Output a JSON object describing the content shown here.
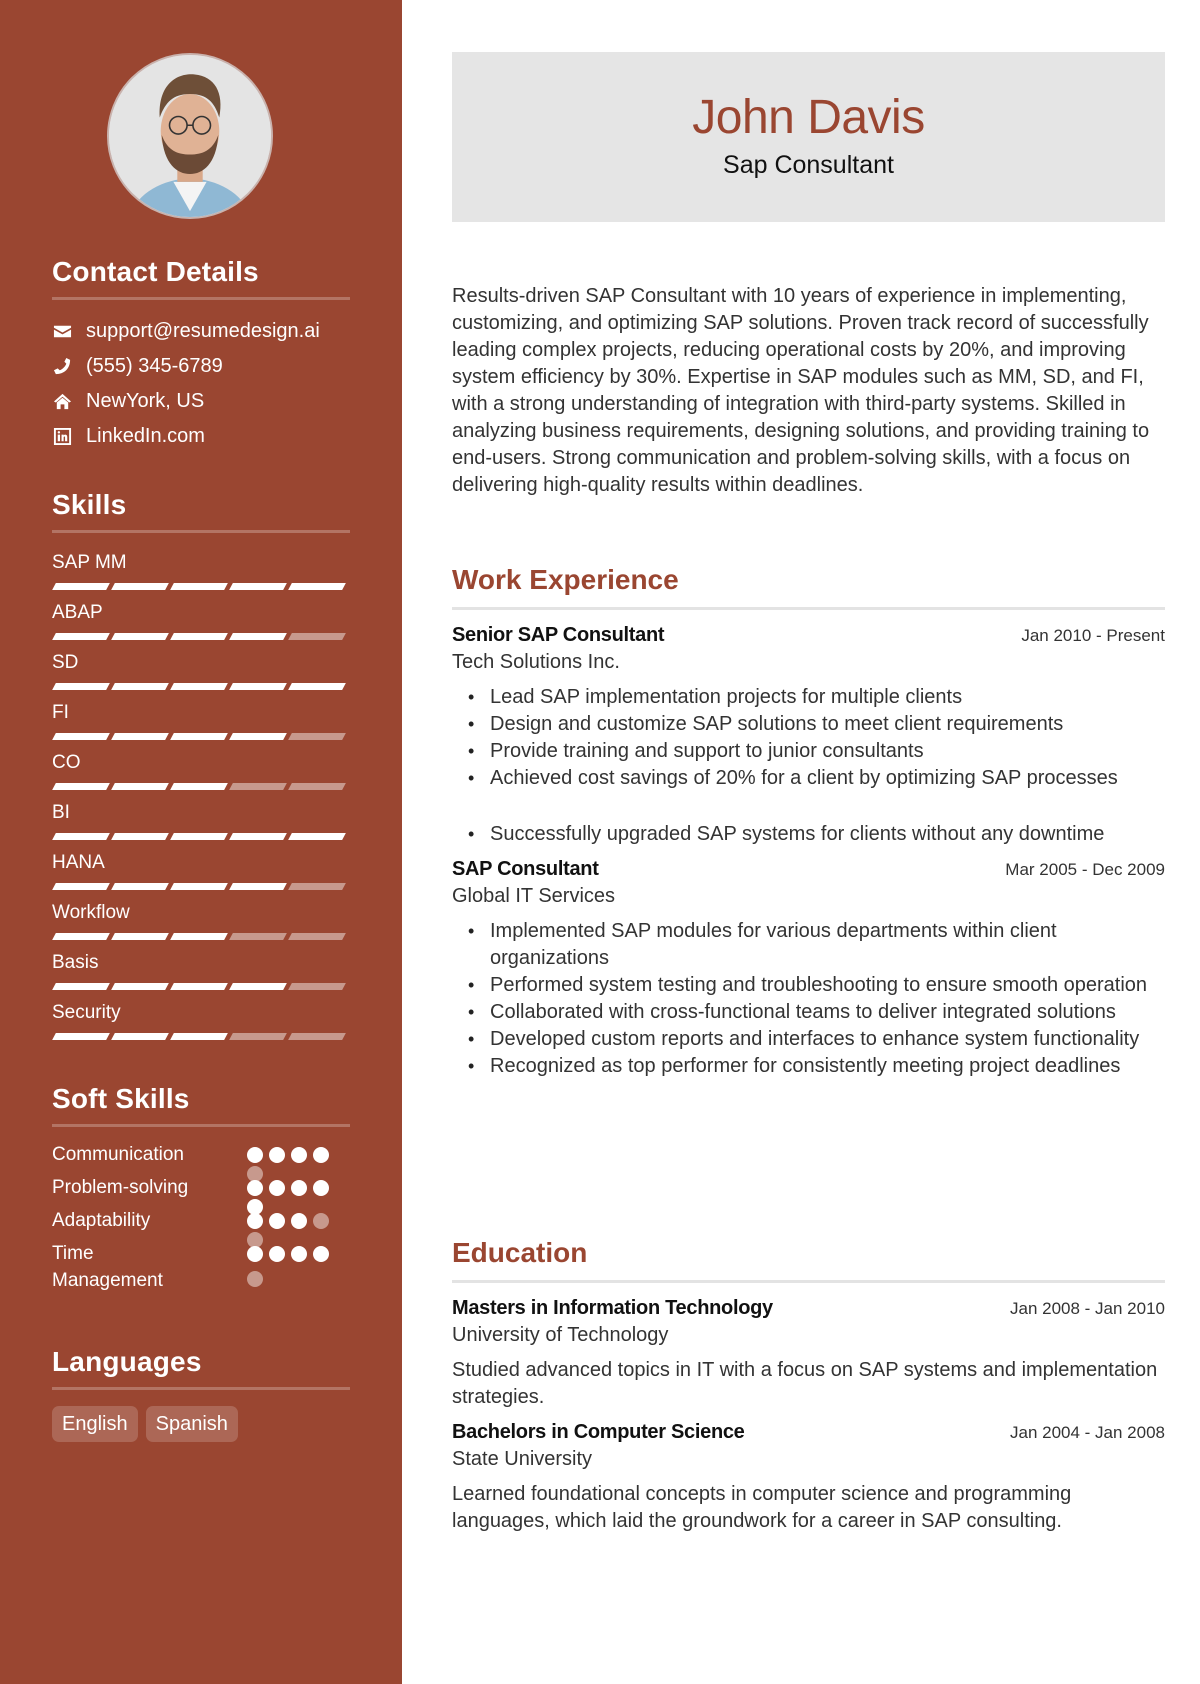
{
  "profile": {
    "name": "John Davis",
    "title": "Sap Consultant",
    "photo_alt": "profile-photo"
  },
  "colors": {
    "accent": "#9A4631",
    "header_bg": "#e5e5e5"
  },
  "contact": {
    "heading": "Contact Details",
    "items": [
      {
        "icon": "envelope-icon",
        "text": "support@resumedesign.ai"
      },
      {
        "icon": "phone-icon",
        "text": "(555) 345-6789"
      },
      {
        "icon": "home-icon",
        "text": "NewYork, US"
      },
      {
        "icon": "linkedin-icon",
        "text": "LinkedIn.com"
      }
    ]
  },
  "skills": {
    "heading": "Skills",
    "max": 5,
    "items": [
      {
        "name": "SAP MM",
        "level": 5
      },
      {
        "name": "ABAP",
        "level": 4
      },
      {
        "name": "SD",
        "level": 5
      },
      {
        "name": "FI",
        "level": 4
      },
      {
        "name": "CO",
        "level": 3
      },
      {
        "name": "BI",
        "level": 5
      },
      {
        "name": "HANA",
        "level": 4
      },
      {
        "name": "Workflow",
        "level": 3
      },
      {
        "name": "Basis",
        "level": 4
      },
      {
        "name": "Security",
        "level": 3
      }
    ]
  },
  "soft_skills": {
    "heading": "Soft Skills",
    "max": 5,
    "items": [
      {
        "name": "Communication",
        "level": 4
      },
      {
        "name": "Problem-solving",
        "level": 5
      },
      {
        "name": "Adaptability",
        "level": 3
      },
      {
        "name": "Time Management",
        "level": 4
      }
    ]
  },
  "languages": {
    "heading": "Languages",
    "items": [
      "English",
      "Spanish"
    ]
  },
  "summary": "Results-driven SAP Consultant with 10 years of experience in implementing, customizing, and optimizing SAP solutions. Proven track record of successfully leading complex projects, reducing operational costs by 20%, and improving system efficiency by 30%. Expertise in SAP modules such as MM, SD, and FI, with a strong understanding of integration with third-party systems. Skilled in analyzing business requirements, designing solutions, and providing training to end-users. Strong communication and problem-solving skills, with a focus on delivering high-quality results within deadlines.",
  "experience": {
    "heading": "Work Experience",
    "items": [
      {
        "title": "Senior SAP Consultant",
        "date": "Jan 2010 - Present",
        "org": "Tech Solutions Inc.",
        "bullets": [
          "Lead SAP implementation projects for multiple clients",
          "Design and customize SAP solutions to meet client requirements",
          "Provide training and support to junior consultants",
          "Achieved cost savings of 20% for a client by optimizing SAP processes",
          "Successfully upgraded SAP systems for clients without any downtime"
        ]
      },
      {
        "title": "SAP Consultant",
        "date": "Mar 2005 - Dec 2009",
        "org": "Global IT Services",
        "bullets": [
          "Implemented SAP modules for various departments within client organizations",
          "Performed system testing and troubleshooting to ensure smooth operation",
          "Collaborated with cross-functional teams to deliver integrated solutions",
          "Developed custom reports and interfaces to enhance system functionality",
          "Recognized as top performer for consistently meeting project deadlines"
        ]
      }
    ]
  },
  "education": {
    "heading": "Education",
    "items": [
      {
        "title": "Masters in Information Technology",
        "date": "Jan 2008 - Jan 2010",
        "org": "University of Technology",
        "desc": "Studied advanced topics in IT with a focus on SAP systems and implementation strategies."
      },
      {
        "title": "Bachelors in Computer Science",
        "date": "Jan 2004 - Jan 2008",
        "org": "State University",
        "desc": "Learned foundational concepts in computer science and programming languages, which laid the groundwork for a career in SAP consulting."
      }
    ]
  }
}
